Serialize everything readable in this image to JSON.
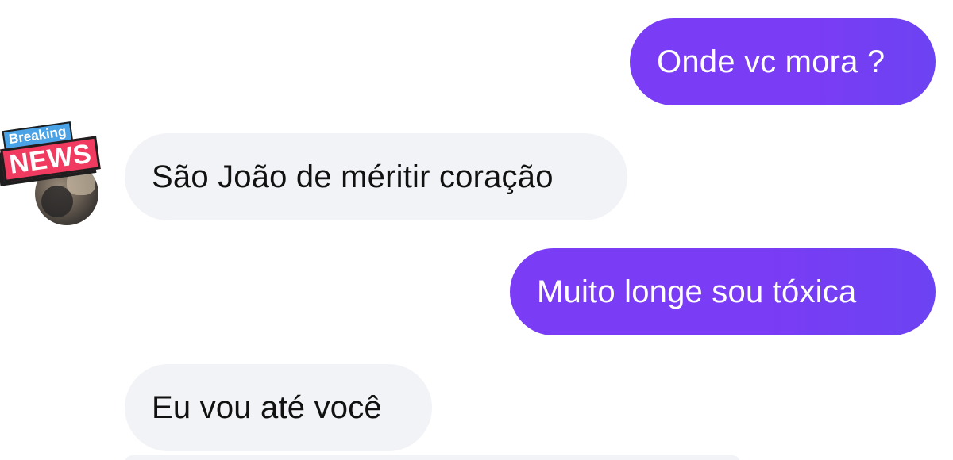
{
  "conversation": {
    "avatar": {
      "badge_top": "Breaking",
      "badge_main": "NEWS"
    },
    "messages": [
      {
        "direction": "outgoing",
        "text": "Onde vc mora ?"
      },
      {
        "direction": "incoming",
        "text": "São João de méritir coração"
      },
      {
        "direction": "outgoing",
        "text": "Muito longe sou tóxica"
      },
      {
        "direction": "incoming",
        "text": "Eu vou até você"
      },
      {
        "direction": "incoming",
        "text": ""
      }
    ],
    "colors": {
      "outgoing_bubble": "#7a3cf4",
      "incoming_bubble": "#f2f3f6",
      "background": "#ffffff"
    }
  }
}
